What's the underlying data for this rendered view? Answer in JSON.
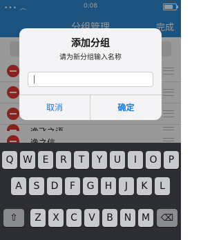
{
  "status_bar": {
    "time": "0:08"
  },
  "nav": {
    "title": "分组管理",
    "done_label": "完成"
  },
  "list": {
    "items": [
      {
        "label": ""
      },
      {
        "label": ""
      },
      {
        "label": ""
      },
      {
        "label": "逸飞之语"
      },
      {
        "label": "逸之信"
      }
    ]
  },
  "dialog": {
    "title": "添加分组",
    "message": "请为新分组输入名称",
    "input_value": "",
    "cancel_label": "取消",
    "confirm_label": "确定"
  },
  "keyboard": {
    "row1": [
      "Q",
      "W",
      "E",
      "R",
      "T",
      "Y",
      "U",
      "I",
      "O",
      "P"
    ],
    "row2": [
      "A",
      "S",
      "D",
      "F",
      "G",
      "H",
      "J",
      "K",
      "L"
    ],
    "row3": [
      "Z",
      "X",
      "C",
      "V",
      "B",
      "N",
      "M"
    ],
    "shift_icon": "shift-icon",
    "delete_icon": "backspace-icon"
  },
  "colors": {
    "nav_blue": "#2f8bd2",
    "delete_red": "#e53935",
    "button_blue": "#1d78d6"
  }
}
